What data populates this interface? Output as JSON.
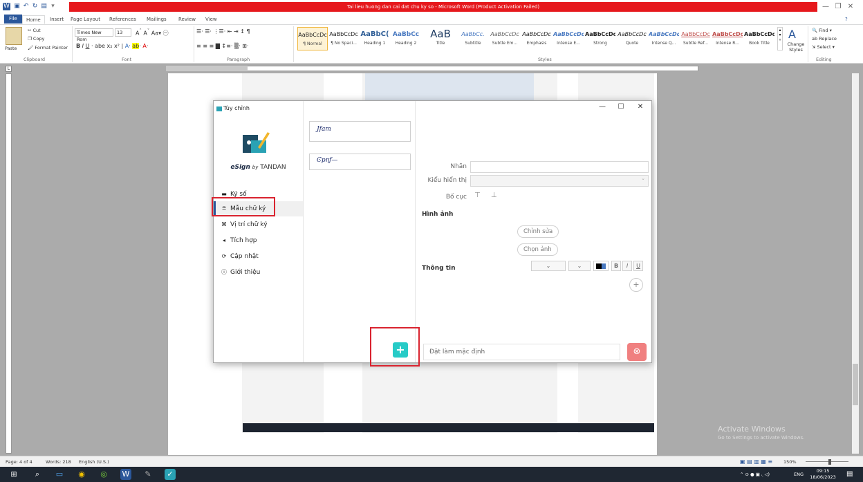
{
  "window": {
    "title": "Tai lieu huong dan cai dat chu ky so  -  Microsoft Word (Product Activation Failed)"
  },
  "ribbon_tabs": [
    "File",
    "Home",
    "Insert",
    "Page Layout",
    "References",
    "Mailings",
    "Review",
    "View"
  ],
  "clipboard": {
    "cut": "Cut",
    "copy": "Copy",
    "paste": "Paste",
    "format_painter": "Format Painter",
    "label": "Clipboard"
  },
  "font": {
    "name": "Times New Rom",
    "size": "13",
    "label": "Font"
  },
  "paragraph": {
    "label": "Paragraph"
  },
  "styles": {
    "label": "Styles",
    "items": [
      {
        "preview": "AaBbCcDc",
        "name": "¶ Normal"
      },
      {
        "preview": "AaBbCcDc",
        "name": "¶ No Spaci..."
      },
      {
        "preview": "AaBbC(",
        "name": "Heading 1"
      },
      {
        "preview": "AaBbCc",
        "name": "Heading 2"
      },
      {
        "preview": "AaB",
        "name": "Title"
      },
      {
        "preview": "AaBbCc.",
        "name": "Subtitle"
      },
      {
        "preview": "AaBbCcDc",
        "name": "Subtle Em..."
      },
      {
        "preview": "AaBbCcDc",
        "name": "Emphasis"
      },
      {
        "preview": "AaBbCcDc",
        "name": "Intense E..."
      },
      {
        "preview": "AaBbCcDc",
        "name": "Strong"
      },
      {
        "preview": "AaBbCcDc",
        "name": "Quote"
      },
      {
        "preview": "AaBbCcDc",
        "name": "Intense Q..."
      },
      {
        "preview": "AaBbCcDc",
        "name": "Subtle Ref..."
      },
      {
        "preview": "AaBbCcDc",
        "name": "Intense R..."
      },
      {
        "preview": "AaBbCcDc",
        "name": "Book Title"
      }
    ],
    "change_styles": "Change Styles"
  },
  "editing": {
    "find": "Find",
    "replace": "Replace",
    "select": "Select",
    "label": "Editing"
  },
  "dialog": {
    "title": "Tùy chỉnh",
    "brand_prefix": "eSign",
    "brand_by": "by",
    "brand_suffix": "TANDAN",
    "nav": [
      {
        "icon": "▬",
        "label": "Ký số"
      },
      {
        "icon": "≞",
        "label": "Mẫu chữ ký"
      },
      {
        "icon": "⌘",
        "label": "Vị trí chữ ký"
      },
      {
        "icon": "◂",
        "label": "Tích hợp"
      },
      {
        "icon": "⟳",
        "label": "Cập nhật"
      },
      {
        "icon": "ⓘ",
        "label": "Giới thiệu"
      }
    ],
    "signatures": [
      "Jfam",
      "Ͼpηf—"
    ],
    "props": {
      "name_label": "Nhãn",
      "display_label": "Kiểu hiển thị",
      "layout_label": "Bố cục",
      "image_section": "Hình ảnh",
      "edit_button": "Chỉnh sửa",
      "choose_button": "Chọn ảnh",
      "info_section": "Thông tin"
    },
    "default_field": "Đặt làm mặc định",
    "add_symbol": "+",
    "close_symbol": "⊗"
  },
  "status": {
    "page": "Page: 4 of 4",
    "words": "Words: 218",
    "lang": "English (U.S.)",
    "zoom": "150%"
  },
  "watermark": {
    "title": "Activate Windows",
    "subtitle": "Go to Settings to activate Windows."
  },
  "tray": {
    "lang": "ENG",
    "time": "09:15",
    "date": "18/06/2023"
  }
}
